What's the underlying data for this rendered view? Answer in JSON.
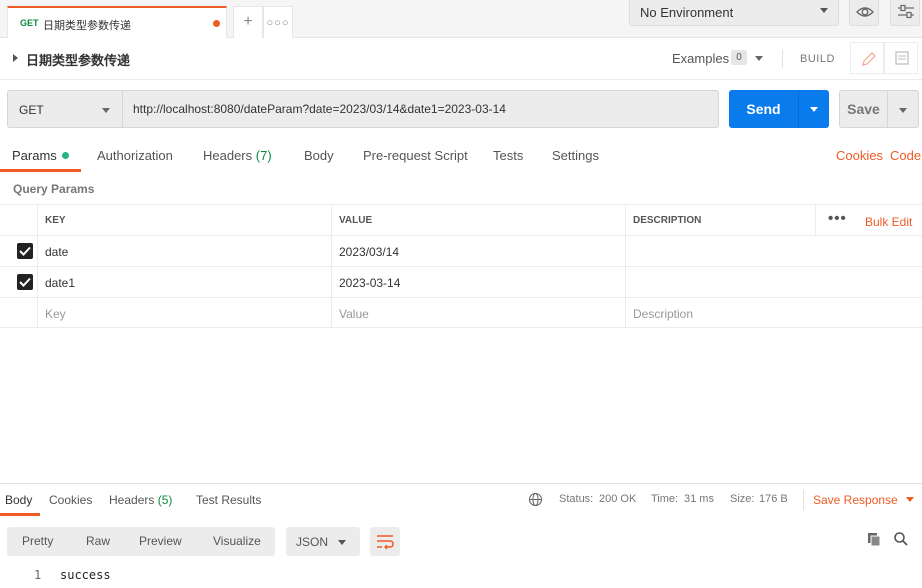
{
  "tab": {
    "method": "GET",
    "name": "日期类型参数传递"
  },
  "environment": {
    "label": "No Environment"
  },
  "request": {
    "title": "日期类型参数传递",
    "examples_label": "Examples",
    "examples_count": "0",
    "build_label": "BUILD",
    "method": "GET",
    "url": "http://localhost:8080/dateParam?date=2023/03/14&date1=2023-03-14",
    "send_label": "Send",
    "save_label": "Save"
  },
  "req_tabs": {
    "params": "Params",
    "authorization": "Authorization",
    "headers": "Headers",
    "headers_count": "(7)",
    "body": "Body",
    "prerequest": "Pre-request Script",
    "tests": "Tests",
    "settings": "Settings",
    "cookies": "Cookies",
    "code": "Code"
  },
  "query_params": {
    "title": "Query Params",
    "columns": {
      "key": "KEY",
      "value": "VALUE",
      "description": "DESCRIPTION"
    },
    "bulk_edit": "Bulk Edit",
    "rows": [
      {
        "key": "date",
        "value": "2023/03/14",
        "description": "",
        "checked": true
      },
      {
        "key": "date1",
        "value": "2023-03-14",
        "description": "",
        "checked": true
      }
    ],
    "placeholders": {
      "key": "Key",
      "value": "Value",
      "description": "Description"
    }
  },
  "response": {
    "tabs": {
      "body": "Body",
      "cookies": "Cookies",
      "headers": "Headers",
      "headers_count": "(5)",
      "test_results": "Test Results"
    },
    "status_label": "Status:",
    "status_value": "200 OK",
    "time_label": "Time:",
    "time_value": "31 ms",
    "size_label": "Size:",
    "size_value": "176 B",
    "save_response": "Save Response",
    "views": {
      "pretty": "Pretty",
      "raw": "Raw",
      "preview": "Preview",
      "visualize": "Visualize"
    },
    "format": "JSON",
    "line_number": "1",
    "body_text": "success"
  },
  "colors": {
    "accent": "#ef5b25",
    "send": "#097bed",
    "success": "#0c8a3e"
  }
}
